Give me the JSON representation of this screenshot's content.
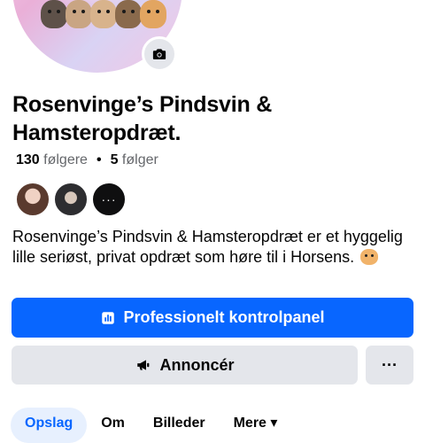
{
  "page": {
    "title": "Rosenvinge’s Pindsvin & Hamsteropdræt.",
    "followers_count": "130",
    "followers_label": "følgere",
    "following_count": "5",
    "following_label": "følger",
    "bio": "Rosenvinge’s Pindsvin & Hamsteropdræt er et hyggelig lille seriøst, privat opdræt som høre til i Horsens.",
    "more_friends_label": "···"
  },
  "buttons": {
    "dashboard_label": "Professionelt kontrolpanel",
    "advertise_label": "Annoncér",
    "more_label": "···"
  },
  "tabs": [
    {
      "label": "Opslag",
      "active": true
    },
    {
      "label": "Om"
    },
    {
      "label": "Billeder"
    },
    {
      "label": "Mere ▾"
    }
  ],
  "icons": {
    "camera": "camera-icon",
    "dashboard": "dashboard-icon",
    "megaphone": "megaphone-icon"
  },
  "colors": {
    "primary": "#0866ff",
    "secondary_button": "#e4e6eb",
    "muted_text": "#65676b"
  }
}
